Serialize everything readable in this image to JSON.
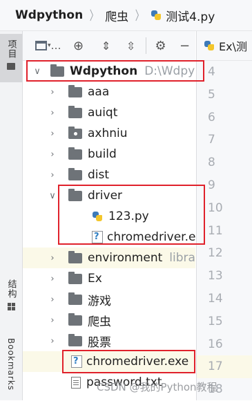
{
  "breadcrumb": {
    "project": "Wdpython",
    "folder": "爬虫",
    "file": "测试4.py"
  },
  "side_tabs": {
    "project": "项目",
    "structure": "结构",
    "bookmarks": "Bookmarks"
  },
  "toolbar": {
    "more": "…"
  },
  "tree": {
    "root_name": "Wdpython",
    "root_path": "D:\\Wdpy",
    "items": [
      {
        "label": "aaa"
      },
      {
        "label": "auiqt"
      },
      {
        "label": "axhniu"
      },
      {
        "label": "build"
      },
      {
        "label": "dist"
      },
      {
        "label": "driver"
      },
      {
        "label": "123.py"
      },
      {
        "label": "chromedriver.e"
      },
      {
        "label": "environment",
        "hint": "libra"
      },
      {
        "label": "Ex"
      },
      {
        "label": "游戏"
      },
      {
        "label": "爬虫"
      },
      {
        "label": "股票"
      },
      {
        "label": "chromedriver.exe"
      },
      {
        "label": "password.txt"
      }
    ]
  },
  "editor": {
    "tab_label": "Ex\\测",
    "line_numbers": [
      "4",
      "5",
      "6",
      "7",
      "8",
      "9",
      "10",
      "11",
      "12",
      "13",
      "14",
      "15",
      "16",
      "17",
      "18"
    ]
  },
  "watermark": "CSDN @我的Python教程",
  "colors": {
    "annotation": "#e0212b",
    "highlight_row": "#fbf9e8",
    "python_blue": "#3d7ab8",
    "python_yellow": "#f3c62b"
  }
}
